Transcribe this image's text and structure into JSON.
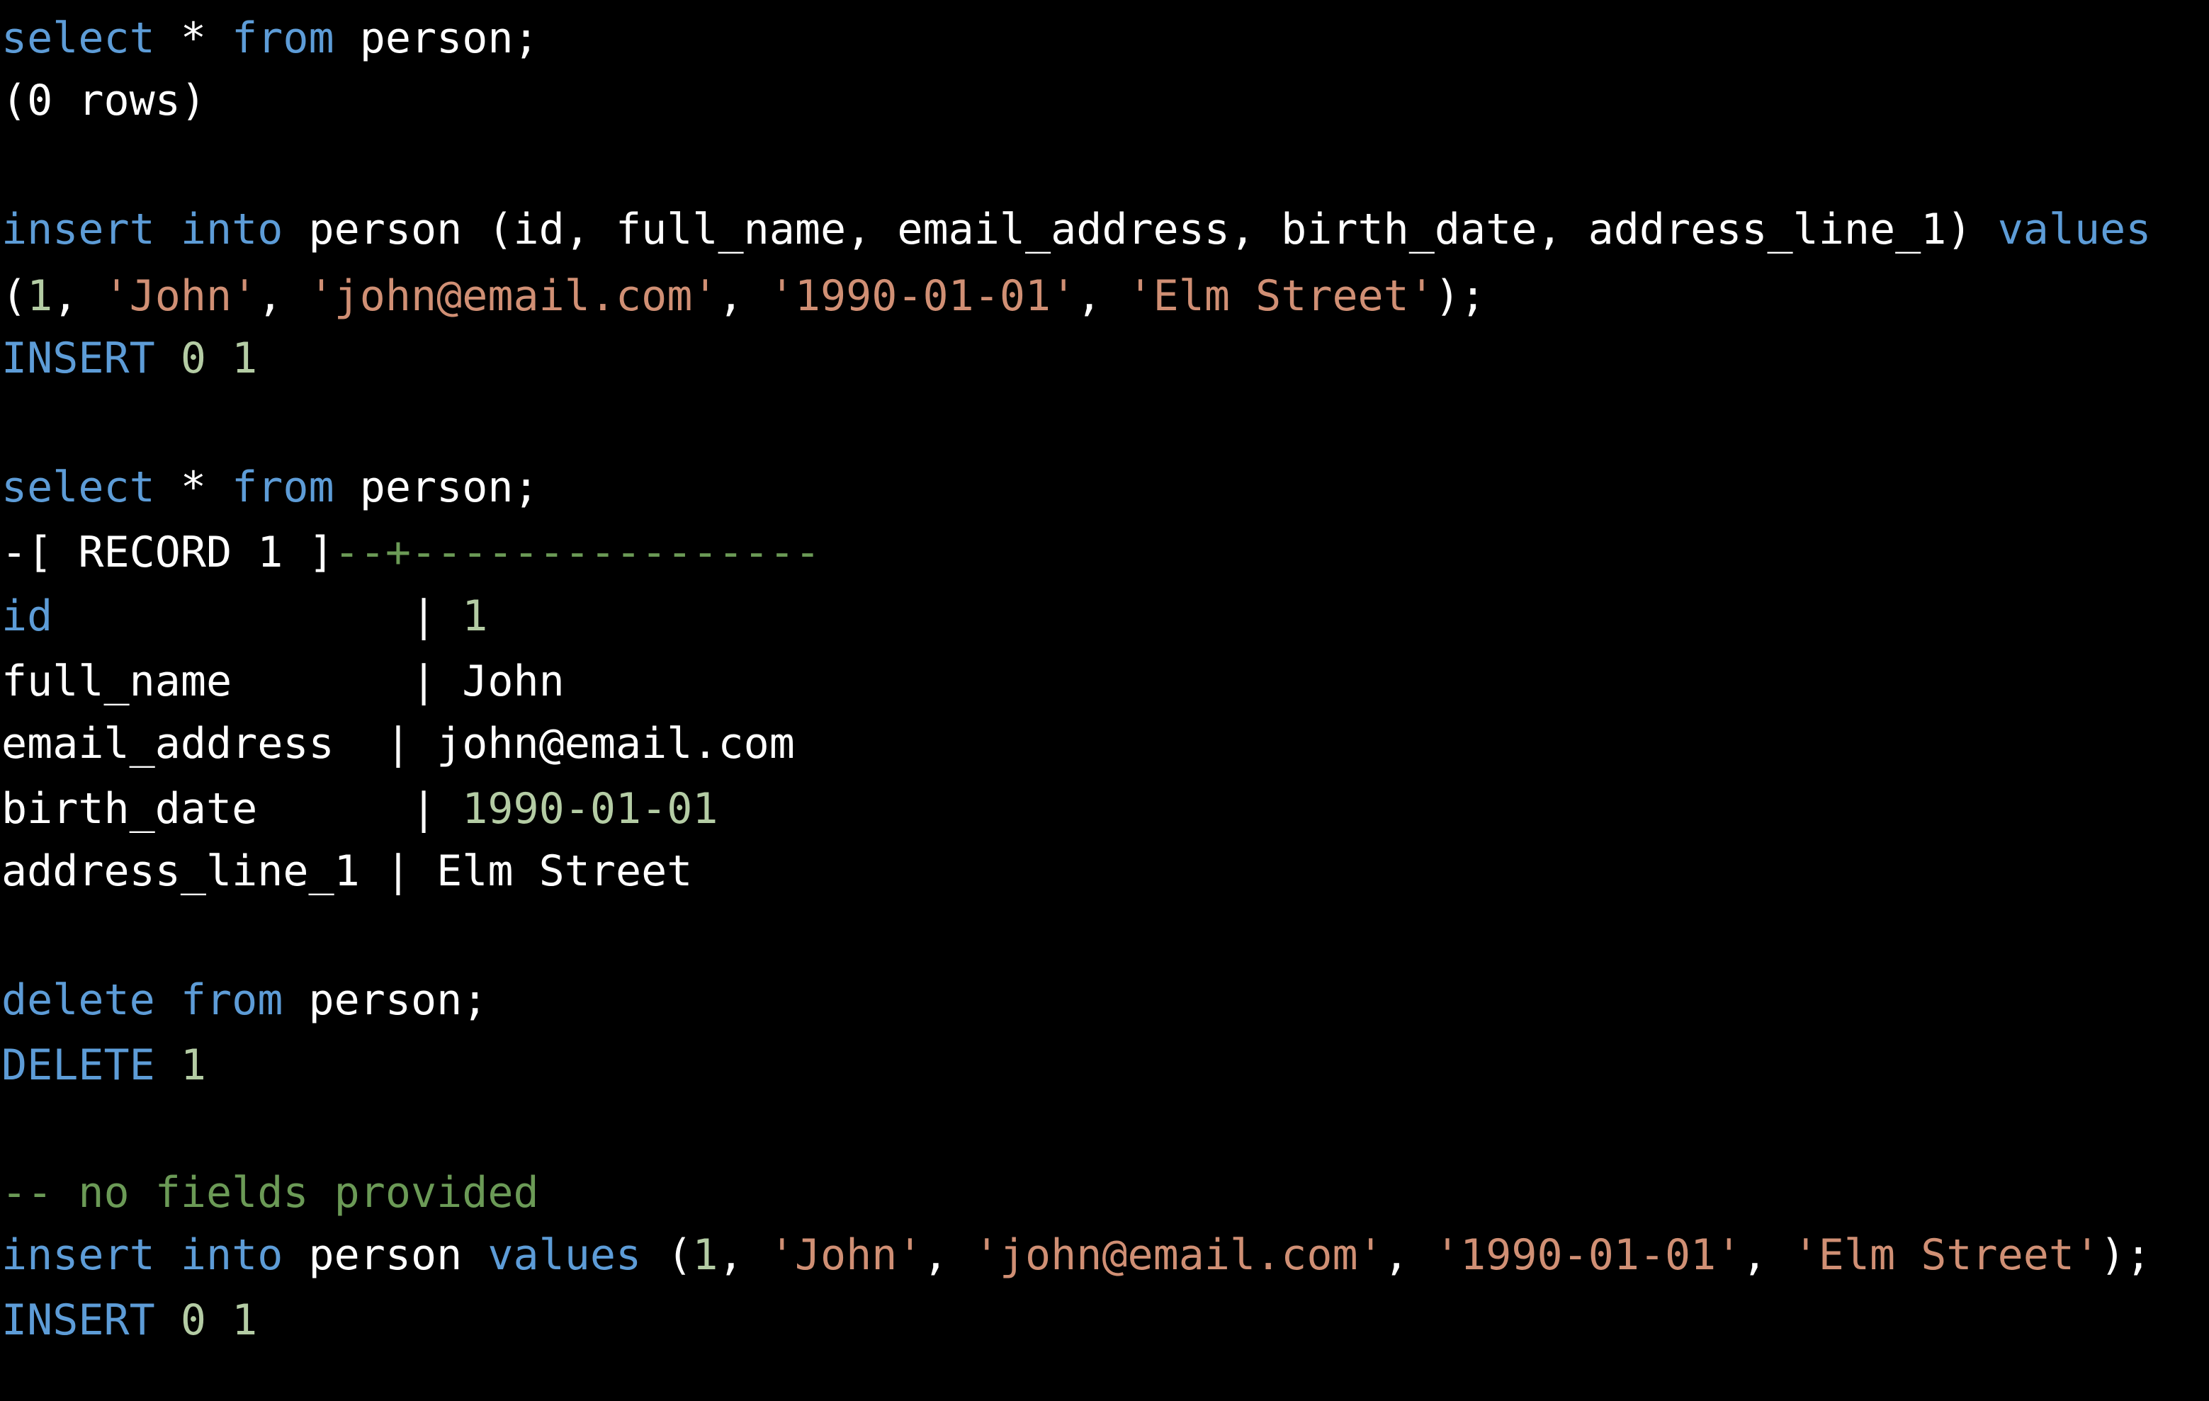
{
  "colors": {
    "background": "#000000",
    "keyword": "#5d9cd7",
    "string": "#d08f74",
    "number": "#b4cca4",
    "comment": "#6b9a56",
    "text": "#ffffff"
  },
  "session": {
    "q1": {
      "select": "select",
      "star": " * ",
      "from": "from",
      "table": " person;",
      "result": "(0 rows)"
    },
    "q2": {
      "insert": "insert",
      "into": "into",
      "mid": " person (id, full_name, email_address, birth_date, address_line_1) ",
      "values": "values",
      "open": "(",
      "v1": "1",
      "c1": ", ",
      "v2": "'John'",
      "c2": ", ",
      "v3": "'john@email.com'",
      "c3": ", ",
      "v4": "'1990-01-01'",
      "c4": ", ",
      "v5": "'Elm Street'",
      "close": ");",
      "result_kw": "INSERT",
      "result_nums": "0 1"
    },
    "q3": {
      "select": "select",
      "star": " * ",
      "from": "from",
      "table": " person;",
      "record_header": "-[ RECORD 1 ]",
      "record_rule": "--+----------------",
      "fields": [
        {
          "name": "id",
          "sep": " | ",
          "value": "1"
        },
        {
          "name": "full_name",
          "sep": " | ",
          "value": "John"
        },
        {
          "name": "email_address",
          "sep": " | ",
          "value": "john@email.com"
        },
        {
          "name": "birth_date",
          "sep": " | ",
          "value": "1990-01-01"
        },
        {
          "name": "address_line_1",
          "sep": " | ",
          "value": "Elm Street"
        }
      ]
    },
    "q4": {
      "delete": "delete",
      "from": "from",
      "table": " person;",
      "result_kw": "DELETE",
      "result_num": "1"
    },
    "q5": {
      "comment": "-- no fields provided",
      "insert": "insert",
      "into": "into",
      "table": " person ",
      "values": "values",
      "open": " (",
      "v1": "1",
      "c1": ", ",
      "v2": "'John'",
      "c2": ", ",
      "v3": "'john@email.com'",
      "c3": ", ",
      "v4": "'1990-01-01'",
      "c4": ", ",
      "v5": "'Elm Street'",
      "close": ");",
      "result_kw": "INSERT",
      "result_nums": "0 1"
    }
  }
}
